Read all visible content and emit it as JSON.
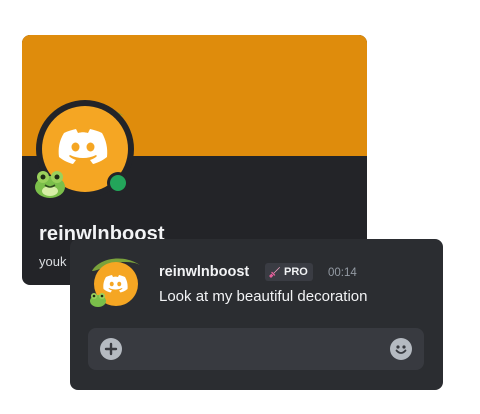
{
  "profile": {
    "display_name": "reinwlnboost",
    "handle": "youk",
    "banner_color": "#df8c0c",
    "status": "online",
    "avatar_icon": "discord-logo-icon",
    "decoration_icon": "frog-leaf-decoration-icon"
  },
  "message": {
    "username": "reinwlnboost",
    "badge_label": "PRO",
    "badge_icon": "pink-sword-icon",
    "timestamp": "00:14",
    "text": "Look at my beautiful decoration"
  },
  "composer": {
    "add_icon": "plus-circle-icon",
    "emoji_icon": "smiley-emoji-icon"
  },
  "colors": {
    "accent_orange": "#f5a623",
    "online_green": "#23a55a",
    "panel_bg": "#2b2d31"
  }
}
